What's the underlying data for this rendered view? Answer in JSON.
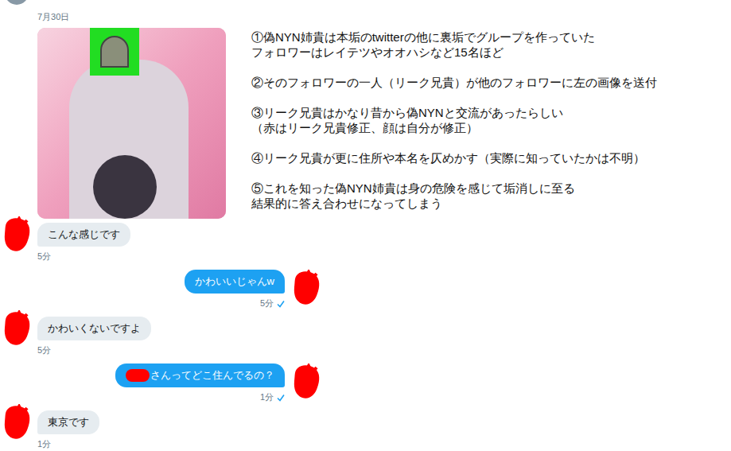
{
  "header": {
    "date": "7月30日"
  },
  "notes": [
    [
      "①偽NYN姉貴は本垢のtwitterの他に裏垢でグループを作っていた",
      "フォロワーはレイテツやオオハシなど15名ほど"
    ],
    [
      "②そのフォロワーの一人（リーク兄貴）が他のフォロワーに左の画像を送付"
    ],
    [
      "③リーク兄貴はかなり昔から偽NYNと交流があったらしい",
      "（赤はリーク兄貴修正、顔は自分が修正）"
    ],
    [
      "④リーク兄貴が更に住所や本名を仄めかす（実際に知っていたかは不明）"
    ],
    [
      "⑤これを知った偽NYN姉貴は身の危険を感じて垢消しに至る",
      "結果的に答え合わせになってしまう"
    ]
  ],
  "messages": [
    {
      "text": "こんな感じです",
      "time": "5分",
      "sent": false,
      "read": false,
      "redacted_prefix": false
    },
    {
      "text": "かわいいじゃんw",
      "time": "5分",
      "sent": true,
      "read": true,
      "redacted_prefix": false
    },
    {
      "text": "かわいくないですよ",
      "time": "5分",
      "sent": false,
      "read": false,
      "redacted_prefix": false
    },
    {
      "text": "さんってどこ住んでるの？",
      "time": "1分",
      "sent": true,
      "read": true,
      "redacted_prefix": true
    },
    {
      "text": "東京です",
      "time": "1分",
      "sent": false,
      "read": false,
      "redacted_prefix": false
    }
  ]
}
